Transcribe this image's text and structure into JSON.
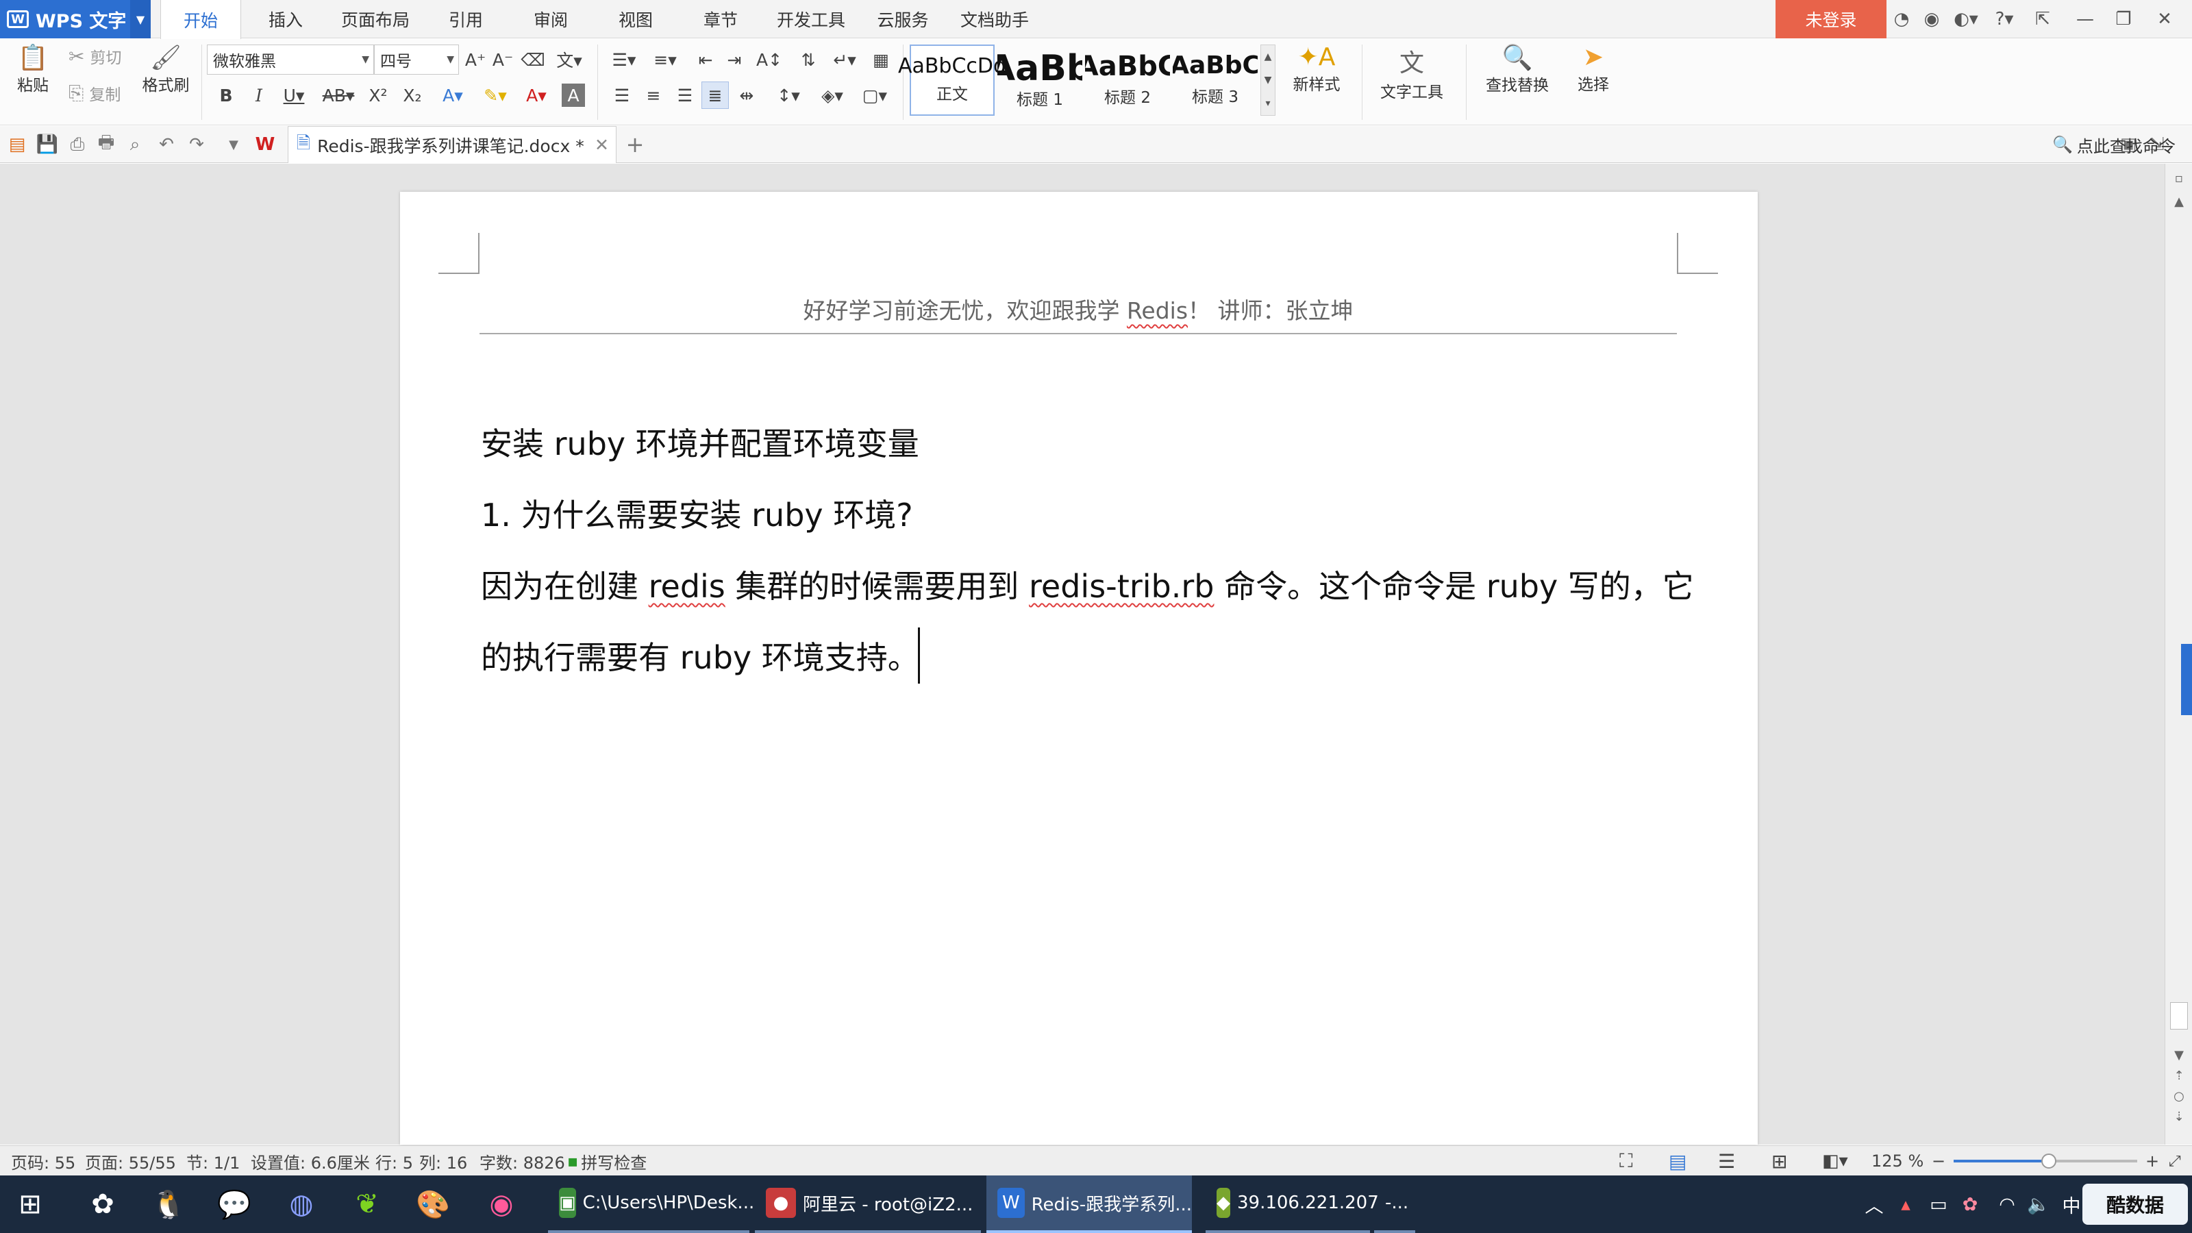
{
  "app": {
    "name": "WPS 文字",
    "logo": "W"
  },
  "menu_tabs": [
    {
      "label": "开始",
      "active": true
    },
    {
      "label": "插入"
    },
    {
      "label": "页面布局"
    },
    {
      "label": "引用"
    },
    {
      "label": "审阅"
    },
    {
      "label": "视图"
    },
    {
      "label": "章节"
    },
    {
      "label": "开发工具"
    },
    {
      "label": "云服务"
    },
    {
      "label": "文档助手"
    }
  ],
  "login_label": "未登录",
  "ribbon": {
    "paste": "粘贴",
    "cut": "剪切",
    "copy": "复制",
    "format_painter": "格式刷",
    "font_name": "微软雅黑",
    "font_size": "四号",
    "styles": [
      {
        "preview": "AaBbCcDd",
        "label": "正文"
      },
      {
        "preview": "AaBb",
        "label": "标题 1"
      },
      {
        "preview": "AaBbC",
        "label": "标题 2"
      },
      {
        "preview": "AaBbC",
        "label": "标题 3"
      }
    ],
    "new_style": "新样式",
    "text_tools": "文字工具",
    "find_replace": "查找替换",
    "select": "选择"
  },
  "doc_tab": {
    "title": "Redis-跟我学系列讲课笔记.docx *"
  },
  "command_search": "点此查找命令",
  "document": {
    "header_pre": "好好学习前途无忧，欢迎跟我学 ",
    "header_redis": "Redis",
    "header_post": "！ 讲师：张立坤",
    "title": "安装 ruby 环境并配置环境变量",
    "question": "1. 为什么需要安装 ruby 环境?",
    "p1_a": "因为在创建 ",
    "p1_redis": "redis",
    "p1_b": " 集群的时候需要用到 ",
    "p1_cmd": "redis-trib.rb",
    "p1_c": " 命令。这个命令是 ruby 写的，它",
    "p2": "的执行需要有 ruby 环境支持。"
  },
  "status": {
    "page_code": "页码: 55",
    "pages": "页面: 55/55",
    "section": "节: 1/1",
    "setting": "设置值: 6.6厘米",
    "row": "行: 5",
    "col": "列: 16",
    "words": "字数: 8826",
    "spell": "拼写检查",
    "zoom": "125 %",
    "zoom_fraction": 0.52
  },
  "taskbar": {
    "tasks": [
      {
        "label": "C:\\Users\\HP\\Desk...",
        "color": "#3c8c3c",
        "glyph": "▣"
      },
      {
        "label": "阿里云 - root@iZ2...",
        "color": "#c83c3c",
        "glyph": "●"
      },
      {
        "label": "Redis-跟我学系列...",
        "color": "#2c6fd1",
        "glyph": "W",
        "active": true
      },
      {
        "label": "39.106.221.207",
        "color": "#7aa62e",
        "glyph": "◆"
      },
      {
        "label": "-...",
        "color": "#1b2a3e",
        "glyph": ""
      }
    ],
    "ime": "中",
    "watermark": "酷数据"
  }
}
